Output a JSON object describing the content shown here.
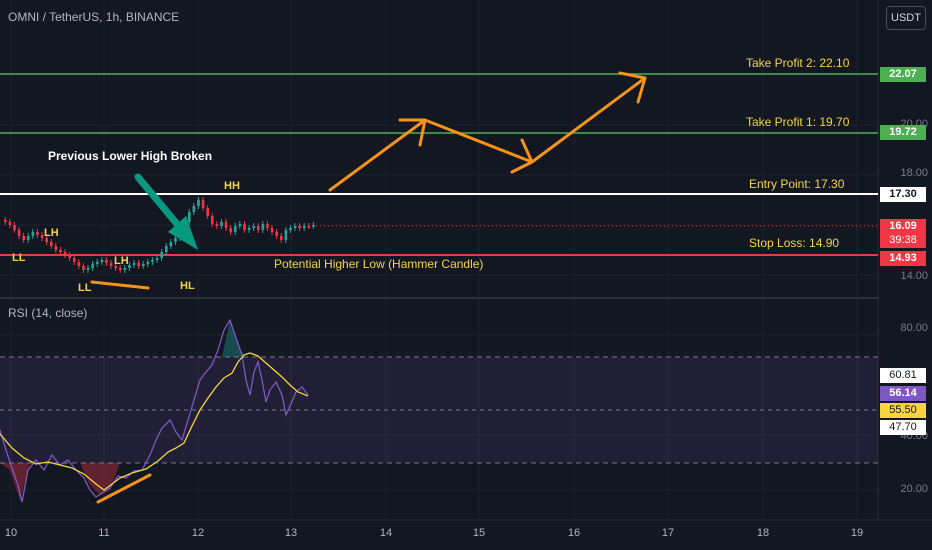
{
  "header": {
    "symbol": "OMNI / TetherUS, 1h, BINANCE",
    "currency_button": "USDT"
  },
  "rsi": {
    "title": "RSI (14, close)"
  },
  "price_axis": {
    "ticks": [
      "20.00",
      "18.00",
      "14.00"
    ]
  },
  "rsi_axis": {
    "ticks": [
      "80.00",
      "40.00",
      "20.00"
    ]
  },
  "price_tags": {
    "tp2": "22.07",
    "tp1": "19.72",
    "entry": "17.30",
    "current": "16.09",
    "countdown": "39:38",
    "stop": "14.93"
  },
  "rsi_tags": {
    "upper": "60.81",
    "rsi": "56.14",
    "ma": "55.50",
    "lower": "47.70"
  },
  "time_axis": [
    "10",
    "11",
    "12",
    "13",
    "14",
    "15",
    "16",
    "17",
    "18",
    "19"
  ],
  "annotations": {
    "take_profit_2": "Take Profit 2: 22.10",
    "take_profit_1": "Take Profit 1: 19.70",
    "entry": "Entry Point: 17.30",
    "stop_loss": "Stop Loss: 14.90",
    "hammer": "Potential Higher Low (Hammer Candle)",
    "lower_high_broken": "Previous Lower High Broken"
  },
  "swing_labels": {
    "ll1": "LL",
    "lh1": "LH",
    "ll2": "LL",
    "lh2": "LH",
    "hl": "HL",
    "hh": "HH"
  },
  "colors": {
    "background": "#131722",
    "take_profit": "#4caf50",
    "entry": "#ffffff",
    "stop": "#f23645",
    "arrow": "#f7931a",
    "teal_arrow": "#089981",
    "rsi_line": "#7e57c2",
    "rsi_ma": "#f5d442",
    "label_yellow": "#f5d442"
  }
}
